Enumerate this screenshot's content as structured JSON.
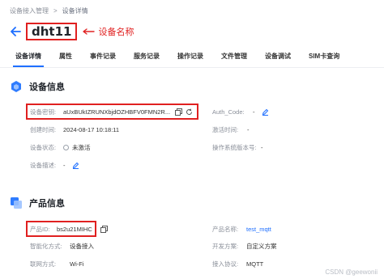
{
  "breadcrumb": {
    "parent": "设备接入管理",
    "separator": ">",
    "current": "设备详情"
  },
  "header": {
    "device_name": "dht11",
    "annotation": "设备名称"
  },
  "tabs": [
    "设备详情",
    "属性",
    "事件记录",
    "服务记录",
    "操作记录",
    "文件管理",
    "设备调试",
    "SIM卡查询"
  ],
  "device_info": {
    "title": "设备信息",
    "secret_label": "设备密钥:",
    "secret_value": "aUxBUkIZRUNXbjdOZHBFV0FMN2R...",
    "auth_code_label": "Auth_Code:",
    "auth_code_value": "-",
    "created_label": "创建时间:",
    "created_value": "2024-08-17 10:18:11",
    "activated_label": "激活时间:",
    "activated_value": "-",
    "status_label": "设备状态:",
    "status_value": "未激活",
    "os_label": "操作系统版本号:",
    "os_value": "-",
    "desc_label": "设备描述:",
    "desc_value": "-"
  },
  "product_info": {
    "title": "产品信息",
    "product_id_label": "产品ID:",
    "product_id_value": "bs2u21MIHC",
    "product_name_label": "产品名称:",
    "product_name_value": "test_mqtt",
    "smart_label": "智能化方式:",
    "smart_value": "设备接入",
    "dev_plan_label": "开发方案:",
    "dev_plan_value": "自定义方案",
    "network_label": "联网方式:",
    "network_value": "Wi-Fi",
    "protocol_label": "接入协议:",
    "protocol_value": "MQTT"
  },
  "watermark": "CSDN @geewonii",
  "colors": {
    "accent": "#1e6fff",
    "annotation": "#e02020",
    "link": "#1e6fff"
  }
}
